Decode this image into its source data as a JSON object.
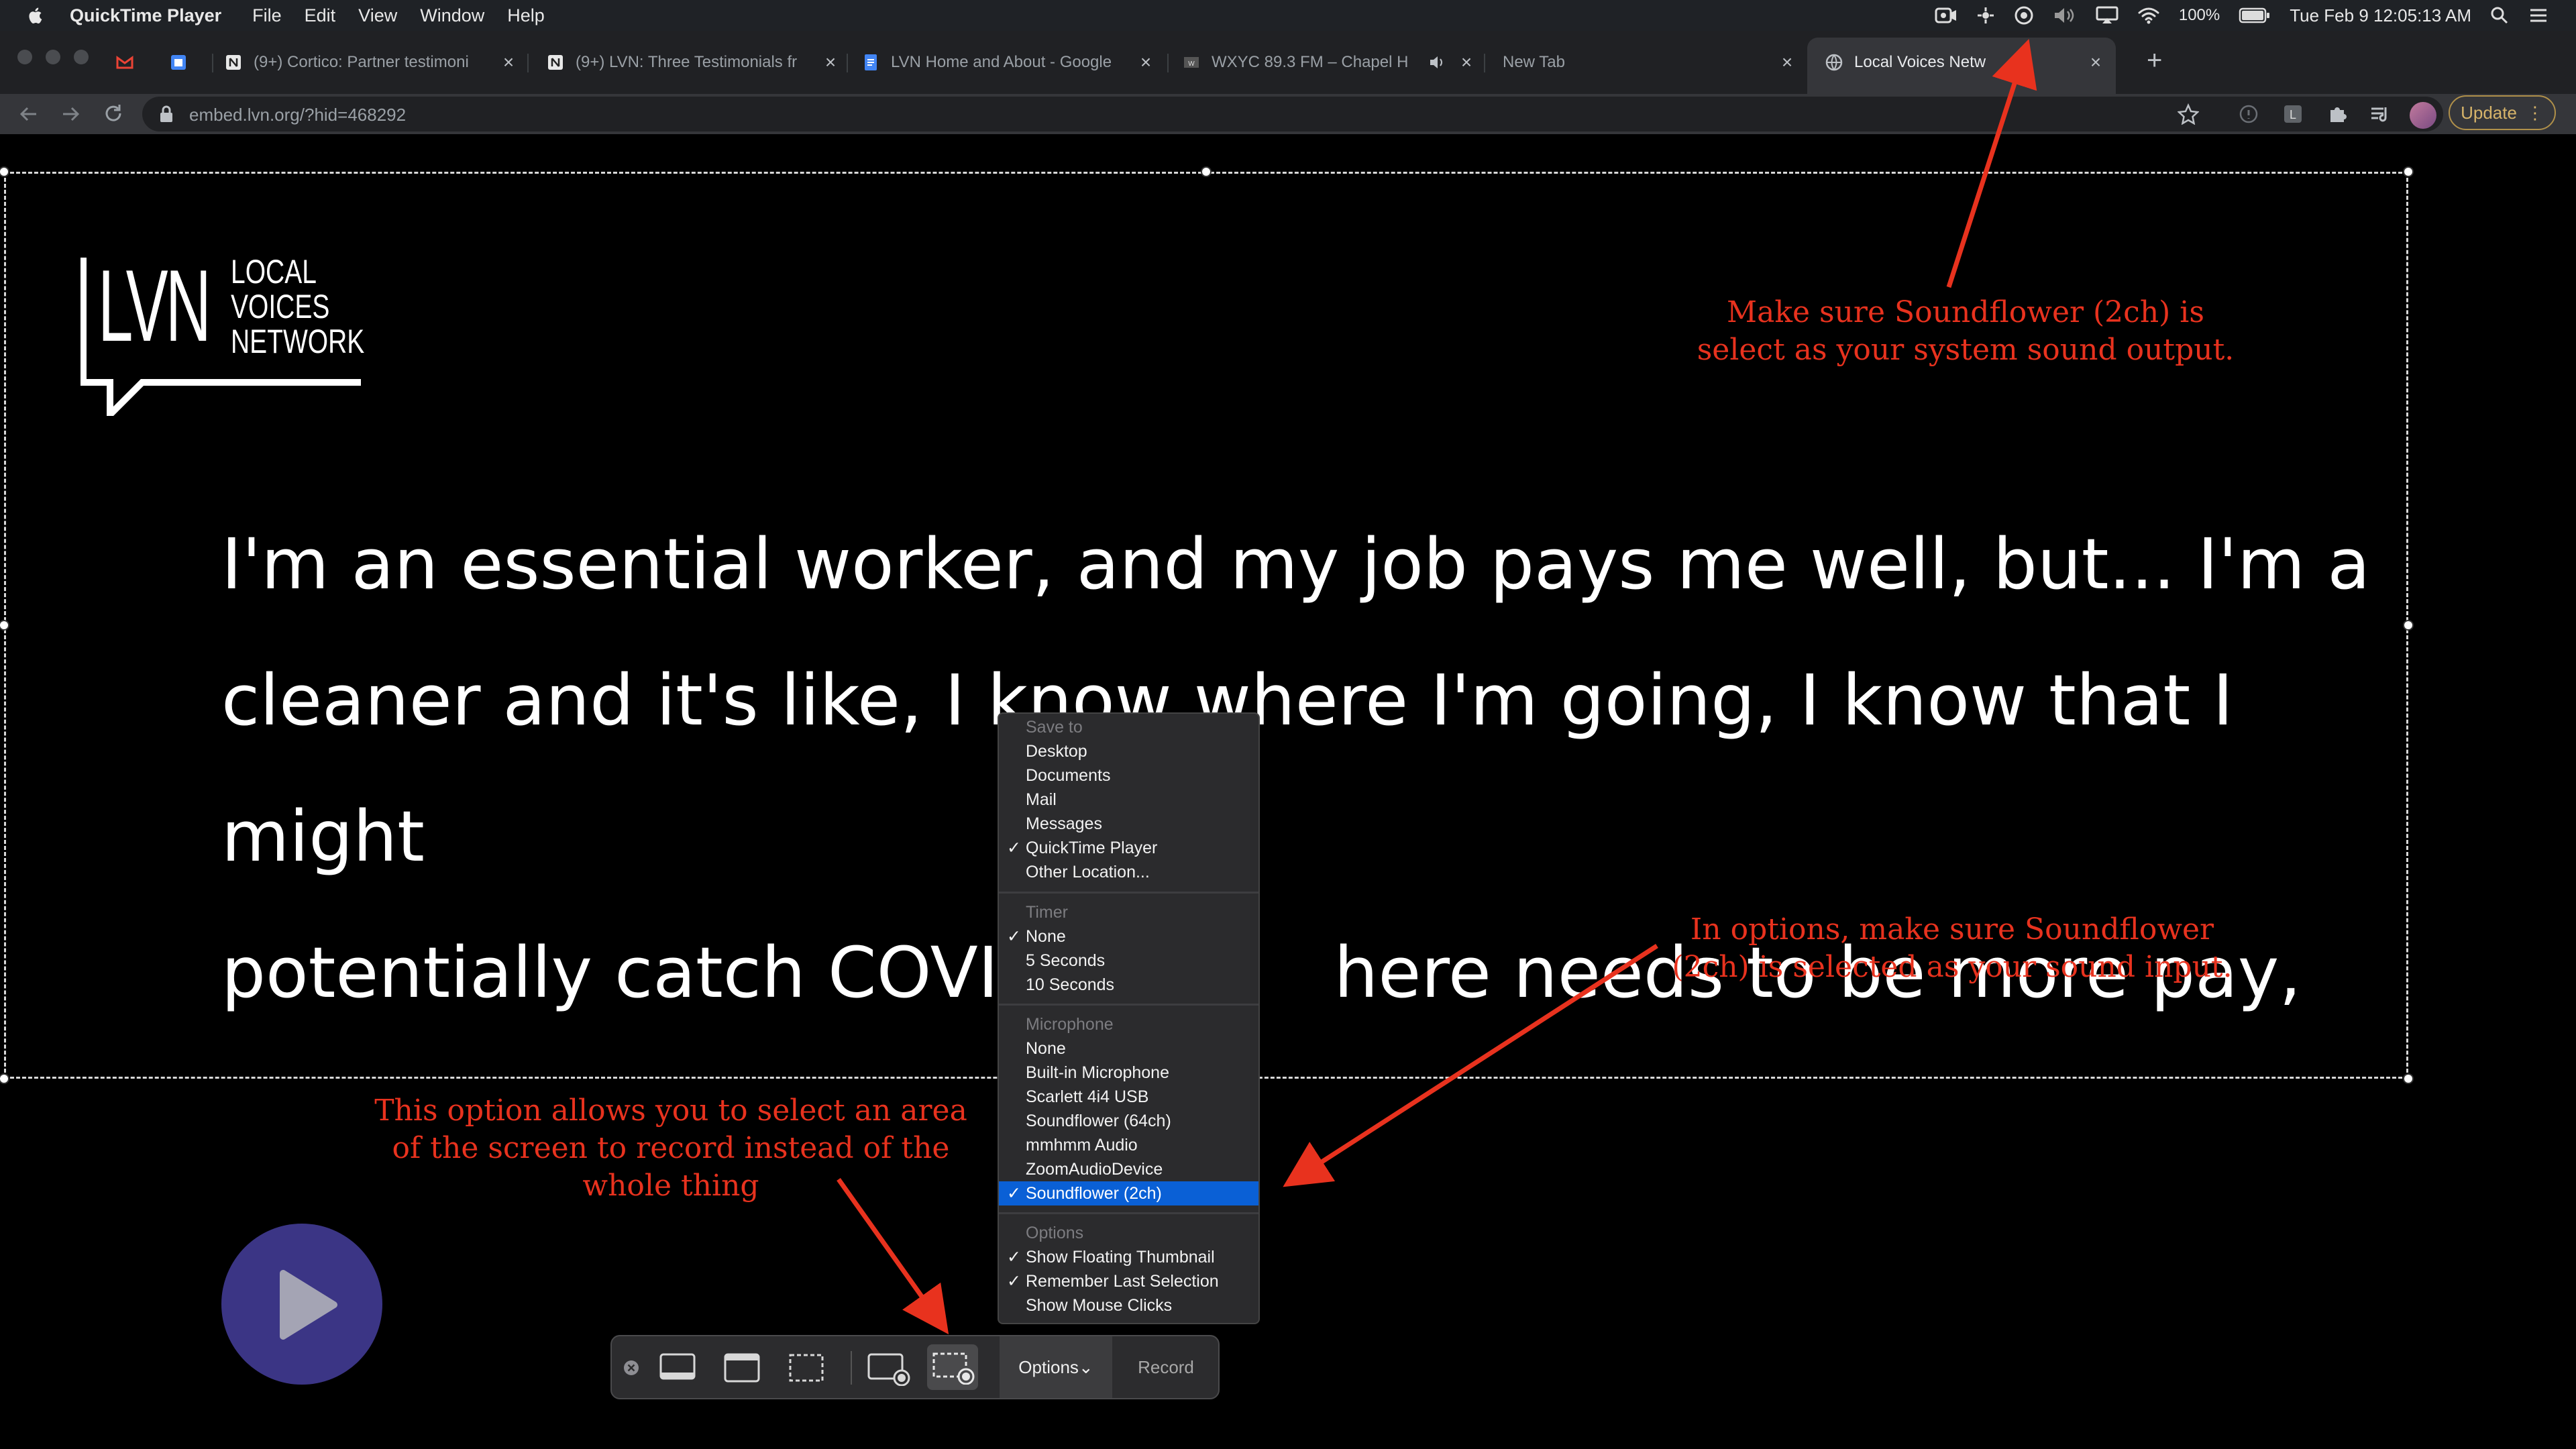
{
  "menubar": {
    "app_name": "QuickTime Player",
    "menus": [
      "File",
      "Edit",
      "View",
      "Window",
      "Help"
    ],
    "battery": "100%",
    "clock": "Tue Feb 9  12:05:13 AM"
  },
  "tabs": [
    {
      "title": "",
      "favicon": "gmail-icon",
      "color": "#ea4335"
    },
    {
      "title": "",
      "favicon": "calendar-icon",
      "color": "#4285f4"
    },
    {
      "title": "(9+) Cortico: Partner testimoni",
      "favicon": "notion-icon",
      "color": "#e0e0e0"
    },
    {
      "title": "(9+) LVN: Three Testimonials fr",
      "favicon": "notion-icon",
      "color": "#e0e0e0"
    },
    {
      "title": "LVN Home and About - Google",
      "favicon": "docs-icon",
      "color": "#4285f4"
    },
    {
      "title": "WXYC 89.3 FM – Chapel H",
      "favicon": "wxyc-icon",
      "color": "#666666"
    },
    {
      "title": "New Tab",
      "favicon": "",
      "color": "#202124"
    },
    {
      "title": "Local Voices Netw",
      "favicon": "globe-icon",
      "color": "#bdc1c6"
    }
  ],
  "toolbar": {
    "url": "embed.lvn.org/?hid=468292",
    "update_label": "Update"
  },
  "page": {
    "logo_letters": "LVN",
    "logo_words": [
      "LOCAL",
      "VOICES",
      "NETWORK"
    ],
    "quote_lines": [
      "I'm an essential worker, and my job pays me well, but... I'm a",
      "cleaner and it's like, I know where I'm going, I know that I might",
      "potentially catch COVID",
      "here needs to be more pay,"
    ]
  },
  "annotations": {
    "sound_output": [
      "Make sure Soundflower (2ch) is",
      "select as your system sound output."
    ],
    "sound_input": [
      "In options, make sure Soundflower",
      "(2ch) is selected as your sound input."
    ],
    "area_select": [
      "This option allows you to select an area",
      "of the screen to record instead of the",
      "whole thing"
    ],
    "arrow_color": "#e8321e"
  },
  "capture_bar": {
    "options_label": "Options⌄",
    "record_label": "Record"
  },
  "options_menu": {
    "save_to": {
      "header": "Save to",
      "items": [
        {
          "label": "Desktop",
          "checked": false
        },
        {
          "label": "Documents",
          "checked": false
        },
        {
          "label": "Mail",
          "checked": false
        },
        {
          "label": "Messages",
          "checked": false
        },
        {
          "label": "QuickTime Player",
          "checked": true
        },
        {
          "label": "Other Location...",
          "checked": false
        }
      ]
    },
    "timer": {
      "header": "Timer",
      "items": [
        {
          "label": "None",
          "checked": true
        },
        {
          "label": "5 Seconds",
          "checked": false
        },
        {
          "label": "10 Seconds",
          "checked": false
        }
      ]
    },
    "microphone": {
      "header": "Microphone",
      "items": [
        {
          "label": "None",
          "checked": false
        },
        {
          "label": "Built-in Microphone",
          "checked": false
        },
        {
          "label": "Scarlett 4i4 USB",
          "checked": false
        },
        {
          "label": "Soundflower (64ch)",
          "checked": false
        },
        {
          "label": "mmhmm Audio",
          "checked": false
        },
        {
          "label": "ZoomAudioDevice",
          "checked": false
        },
        {
          "label": "Soundflower (2ch)",
          "checked": true,
          "highlighted": true
        }
      ]
    },
    "options": {
      "header": "Options",
      "items": [
        {
          "label": "Show Floating Thumbnail",
          "checked": true
        },
        {
          "label": "Remember Last Selection",
          "checked": true
        },
        {
          "label": "Show Mouse Clicks",
          "checked": false
        }
      ]
    },
    "checkmark": "✓"
  }
}
